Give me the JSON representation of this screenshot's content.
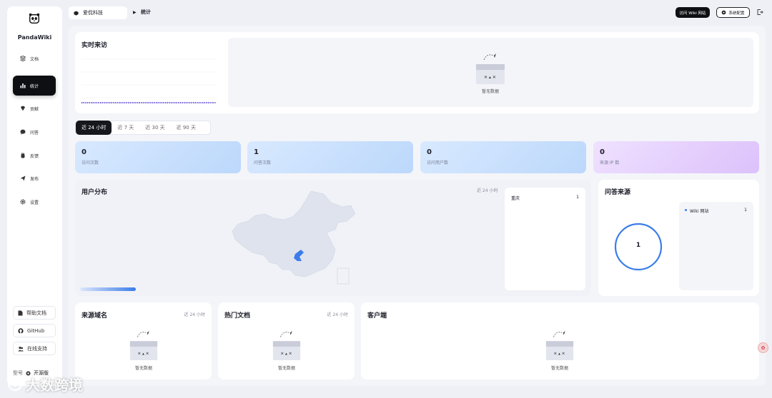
{
  "app": {
    "brand": "PandaWiki"
  },
  "sidebar": {
    "items": [
      {
        "label": "文档",
        "icon": "docs-icon"
      },
      {
        "label": "统计",
        "icon": "chart-icon"
      },
      {
        "label": "贡献",
        "icon": "gem-icon"
      },
      {
        "label": "问答",
        "icon": "chat-icon"
      },
      {
        "label": "反馈",
        "icon": "hand-icon"
      },
      {
        "label": "发布",
        "icon": "send-icon"
      },
      {
        "label": "设置",
        "icon": "gear-icon"
      }
    ],
    "help": "帮助文档",
    "github": "GitHub",
    "support": "在线支持",
    "version_label": "型号",
    "version_value": "开源版"
  },
  "header": {
    "workspace": "爱侃科技",
    "current": "统计",
    "visit_wiki": "访问 Wiki 网站",
    "settings": "系统配置"
  },
  "realtime": {
    "title": "实时来访",
    "empty": "暂无数据"
  },
  "tabs": [
    "近 24 小时",
    "近 7 天",
    "近 30 天",
    "近 90 天"
  ],
  "stats": [
    {
      "value": "0",
      "label": "访问次数"
    },
    {
      "value": "1",
      "label": "问答次数"
    },
    {
      "value": "0",
      "label": "访问用户数"
    },
    {
      "value": "0",
      "label": "来源 IP 数"
    }
  ],
  "user_dist": {
    "title": "用户分布",
    "range": "近 24 小时",
    "list": [
      {
        "name": "重庆",
        "count": "1"
      }
    ]
  },
  "qa_source": {
    "title": "问答来源",
    "center_value": "1",
    "list": [
      {
        "name": "Wiki 网站",
        "count": "1"
      }
    ]
  },
  "domains": {
    "title": "来源域名",
    "range": "近 24 小时",
    "empty": "暂无数据"
  },
  "hot_docs": {
    "title": "热门文档",
    "range": "近 24 小时",
    "empty": "暂无数据"
  },
  "clients": {
    "title": "客户端",
    "empty": "暂无数据"
  },
  "watermark": "大数跨境",
  "colors": {
    "accent": "#3b7de9",
    "dark": "#0e0f13",
    "purple": "#7b4fe0"
  }
}
